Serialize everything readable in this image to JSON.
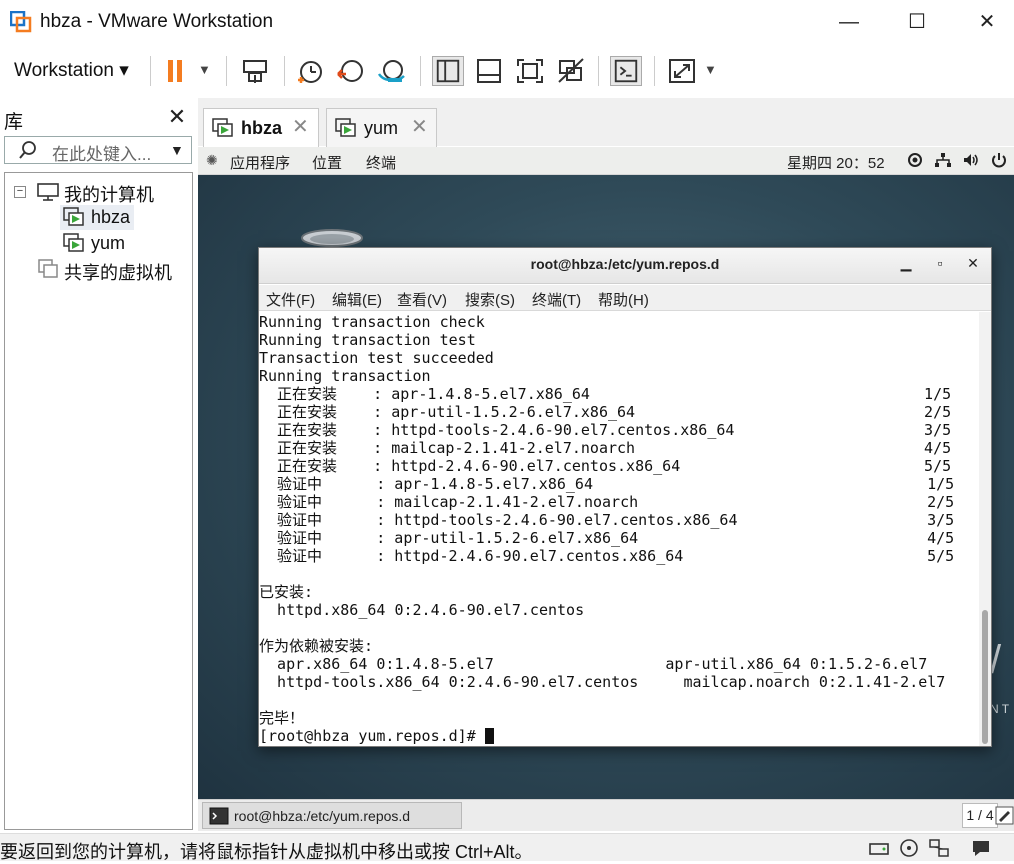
{
  "window": {
    "title": "hbza - VMware Workstation"
  },
  "toolbar": {
    "workstation_menu": "Workstation"
  },
  "library": {
    "title": "库",
    "search_placeholder": "在此处键入...",
    "tree": [
      {
        "label": "我的计算机"
      },
      {
        "label": "hbza"
      },
      {
        "label": "yum"
      },
      {
        "label": "共享的虚拟机"
      }
    ]
  },
  "tabs": [
    {
      "label": "hbza",
      "active": true
    },
    {
      "label": "yum",
      "active": false
    }
  ],
  "guest_topbar": {
    "applications": "应用程序",
    "places": "位置",
    "terminal": "终端",
    "clock": "星期四 20：52"
  },
  "terminal": {
    "title": "root@hbza:/etc/yum.repos.d",
    "menu": [
      "文件(F)",
      "编辑(E)",
      "查看(V)",
      "搜索(S)",
      "终端(T)",
      "帮助(H)"
    ],
    "lines": [
      "Running transaction check",
      "Running transaction test",
      "Transaction test succeeded",
      "Running transaction",
      "  正在安装    : apr-1.4.8-5.el7.x86_64                                     1/5",
      "  正在安装    : apr-util-1.5.2-6.el7.x86_64                                2/5",
      "  正在安装    : httpd-tools-2.4.6-90.el7.centos.x86_64                     3/5",
      "  正在安装    : mailcap-2.1.41-2.el7.noarch                                4/5",
      "  正在安装    : httpd-2.4.6-90.el7.centos.x86_64                           5/5",
      "  验证中      : apr-1.4.8-5.el7.x86_64                                     1/5",
      "  验证中      : mailcap-2.1.41-2.el7.noarch                                2/5",
      "  验证中      : httpd-tools-2.4.6-90.el7.centos.x86_64                     3/5",
      "  验证中      : apr-util-1.5.2-6.el7.x86_64                                4/5",
      "  验证中      : httpd-2.4.6-90.el7.centos.x86_64                           5/5",
      "",
      "已安装:",
      "  httpd.x86_64 0:2.4.6-90.el7.centos",
      "",
      "作为依赖被安装:",
      "  apr.x86_64 0:1.4.8-5.el7                   apr-util.x86_64 0:1.5.2-6.el7",
      "  httpd-tools.x86_64 0:2.4.6-90.el7.centos     mailcap.noarch 0:2.1.41-2.el7",
      "",
      "完毕！"
    ],
    "prompt": "[root@hbza yum.repos.d]# "
  },
  "guest_taskbar": {
    "item_label": "root@hbza:/etc/yum.repos.d",
    "pager": "1 / 4"
  },
  "statusbar": {
    "text": "要返回到您的计算机，请将鼠标指针从虚拟机中移出或按 Ctrl+Alt。"
  },
  "colors": {
    "pause_orange": "#f47c20",
    "vmware_blue": "#1a73c8",
    "play_green": "#3aa63a"
  }
}
